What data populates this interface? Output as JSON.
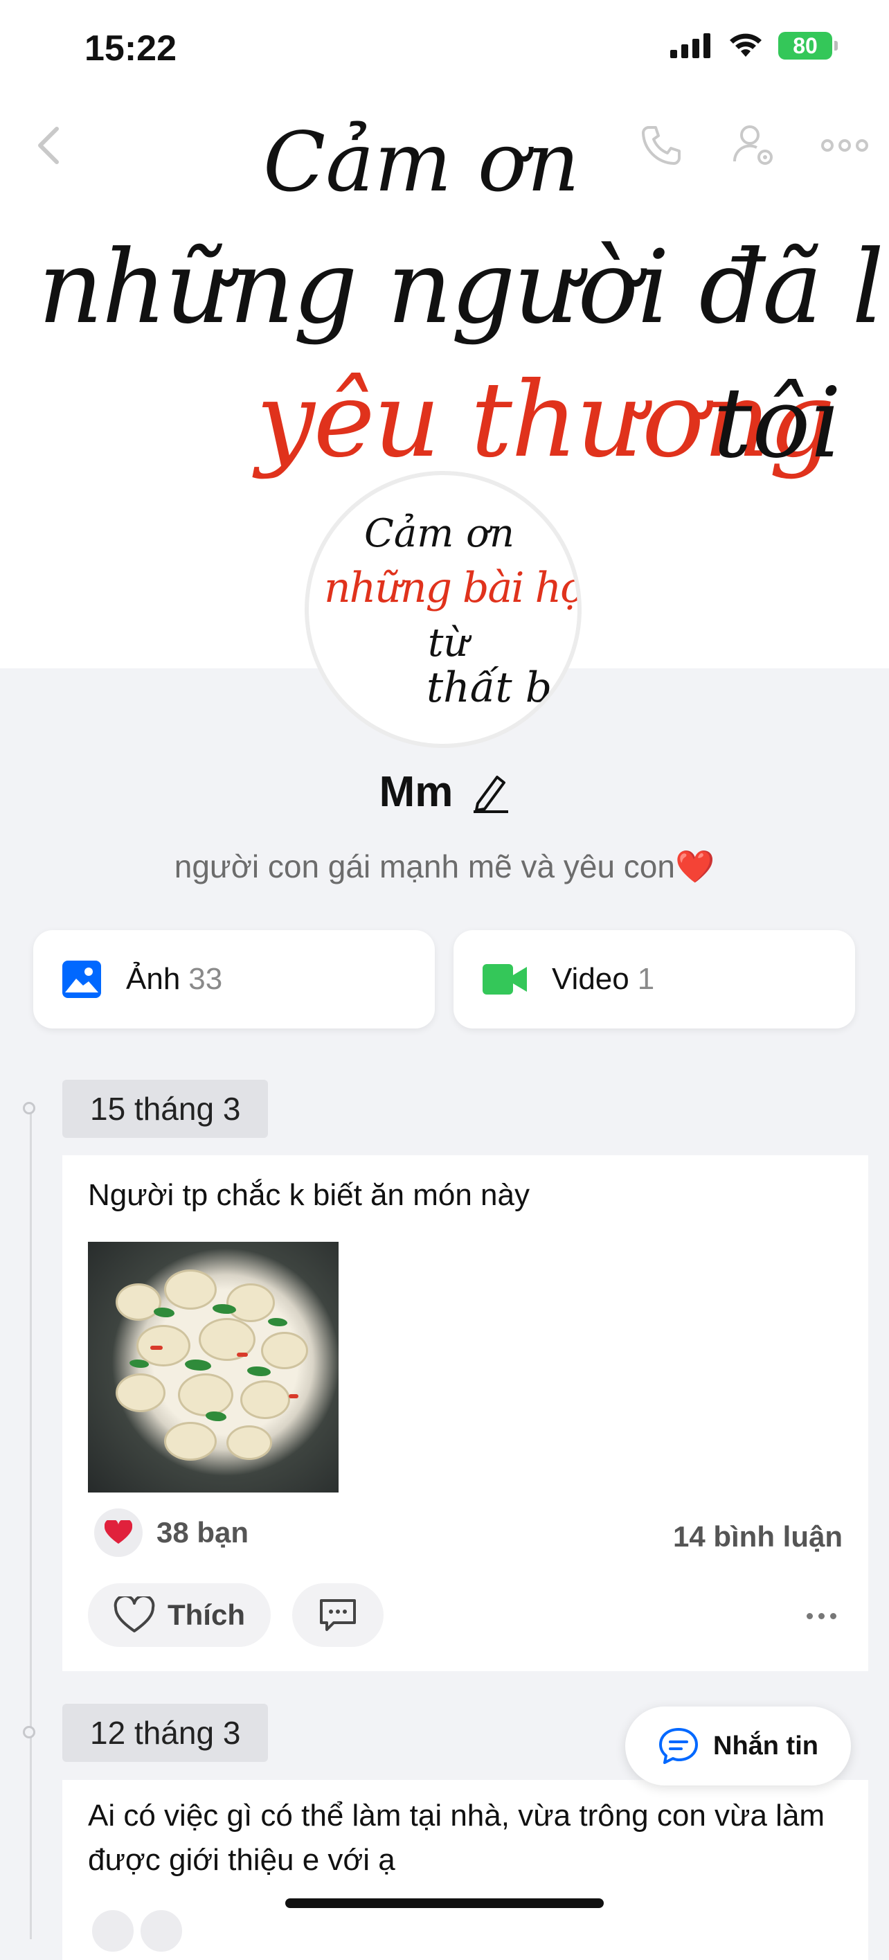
{
  "status_bar": {
    "time": "15:22",
    "battery": "80"
  },
  "cover": {
    "line1": "Cảm ơn",
    "line2": "những người đã luôn",
    "line3_highlight": "yêu thương",
    "line3_end": "tôi"
  },
  "avatar": {
    "line1": "Cảm ơn",
    "line2": "những bài học",
    "line3": "từ",
    "line4": "thất bại"
  },
  "profile": {
    "name": "Mm",
    "bio": "người con gái mạnh mẽ và yêu con❤️"
  },
  "media": {
    "photos_label": "Ảnh",
    "photos_count": "33",
    "videos_label": "Video",
    "videos_count": "1"
  },
  "posts": [
    {
      "date": "15 tháng 3",
      "text": "Người tp chắc k biết ăn món này",
      "reactions": "38 bạn",
      "comments": "14 bình luận",
      "like_label": "Thích"
    },
    {
      "date": "12 tháng 3",
      "text": "Ai có việc gì có thể làm tại nhà, vừa trông con vừa làm được giới thiệu e với ạ"
    }
  ],
  "message_button": {
    "label": "Nhắn tin"
  },
  "colors": {
    "accent": "#0068ff",
    "like_red": "#e0321c",
    "video_green": "#34c759"
  }
}
